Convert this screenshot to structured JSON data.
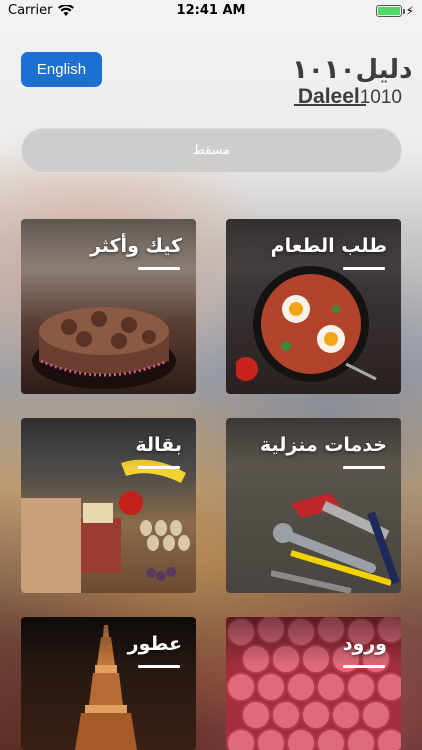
{
  "status_bar": {
    "carrier": "Carrier",
    "time": "12:41 AM"
  },
  "header": {
    "language_button": "English",
    "logo_arabic": "دليل١٠١٠",
    "logo_latin": "Daleel",
    "logo_number": "1010"
  },
  "search": {
    "value": "مسقط"
  },
  "categories": [
    {
      "label": "كيك وأكثر",
      "icon": "cake"
    },
    {
      "label": "طلب الطعام",
      "icon": "food-pan"
    },
    {
      "label": "بقالة",
      "icon": "groceries"
    },
    {
      "label": "خدمات منزلية",
      "icon": "tools"
    },
    {
      "label": "عطور",
      "icon": "perfume"
    },
    {
      "label": "ورود",
      "icon": "roses"
    }
  ],
  "colors": {
    "accent": "#1d6fd1",
    "battery": "#4cd964"
  }
}
